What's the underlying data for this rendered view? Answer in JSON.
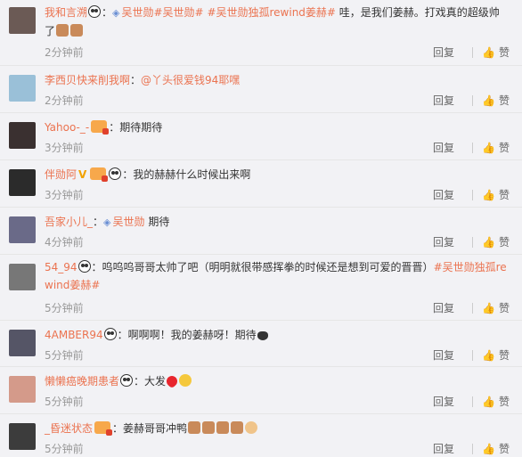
{
  "actions": {
    "reply": "回复",
    "like": "赞"
  },
  "comments": [
    {
      "name": "我和言溯",
      "parts": [
        " ",
        "吴世勋#吴世勋#",
        " #吴世勋独孤rewind姜赫#",
        " 哇，是我们姜赫。打戏真的超级帅了"
      ],
      "time": "2分钟前",
      "avatar": "#6b5a55"
    },
    {
      "name": "李西贝快来削我啊",
      "parts": [
        "：",
        "@丫头很爱钱94耶嘿"
      ],
      "time": "2分钟前",
      "avatar": "#9ac0d8"
    },
    {
      "name": "Yahoo-_-",
      "parts": [
        "：期待期待"
      ],
      "time": "3分钟前",
      "avatar": "#3a3030"
    },
    {
      "name": "伴勋阿",
      "parts": [
        "：我的赫赫什么时候出来啊"
      ],
      "time": "3分钟前",
      "avatar": "#2b2b2b"
    },
    {
      "name": "吾家小儿_",
      "parts": [
        "：",
        "吴世勋",
        " 期待"
      ],
      "time": "4分钟前",
      "avatar": "#6a6a88"
    },
    {
      "name": "54_94",
      "parts": [
        "：呜呜呜哥哥太帅了吧（明明就很带感挥拳的时候还是想到可爱的晋晋）",
        "#吴世勋独孤rewind姜赫#"
      ],
      "time": "5分钟前",
      "avatar": "#777"
    },
    {
      "name": "4AMBER94",
      "parts": [
        "：啊啊啊！我的姜赫呀！期待"
      ],
      "time": "5分钟前",
      "avatar": "#556"
    },
    {
      "name": "懒懒癌晚期患者",
      "parts": [
        "：大发"
      ],
      "time": "5分钟前",
      "avatar": "#d49a8a"
    },
    {
      "name": "_昏迷状态",
      "parts": [
        "：姜赫哥哥冲鸭"
      ],
      "time": "5分钟前",
      "avatar": "#3c3c3c"
    }
  ]
}
